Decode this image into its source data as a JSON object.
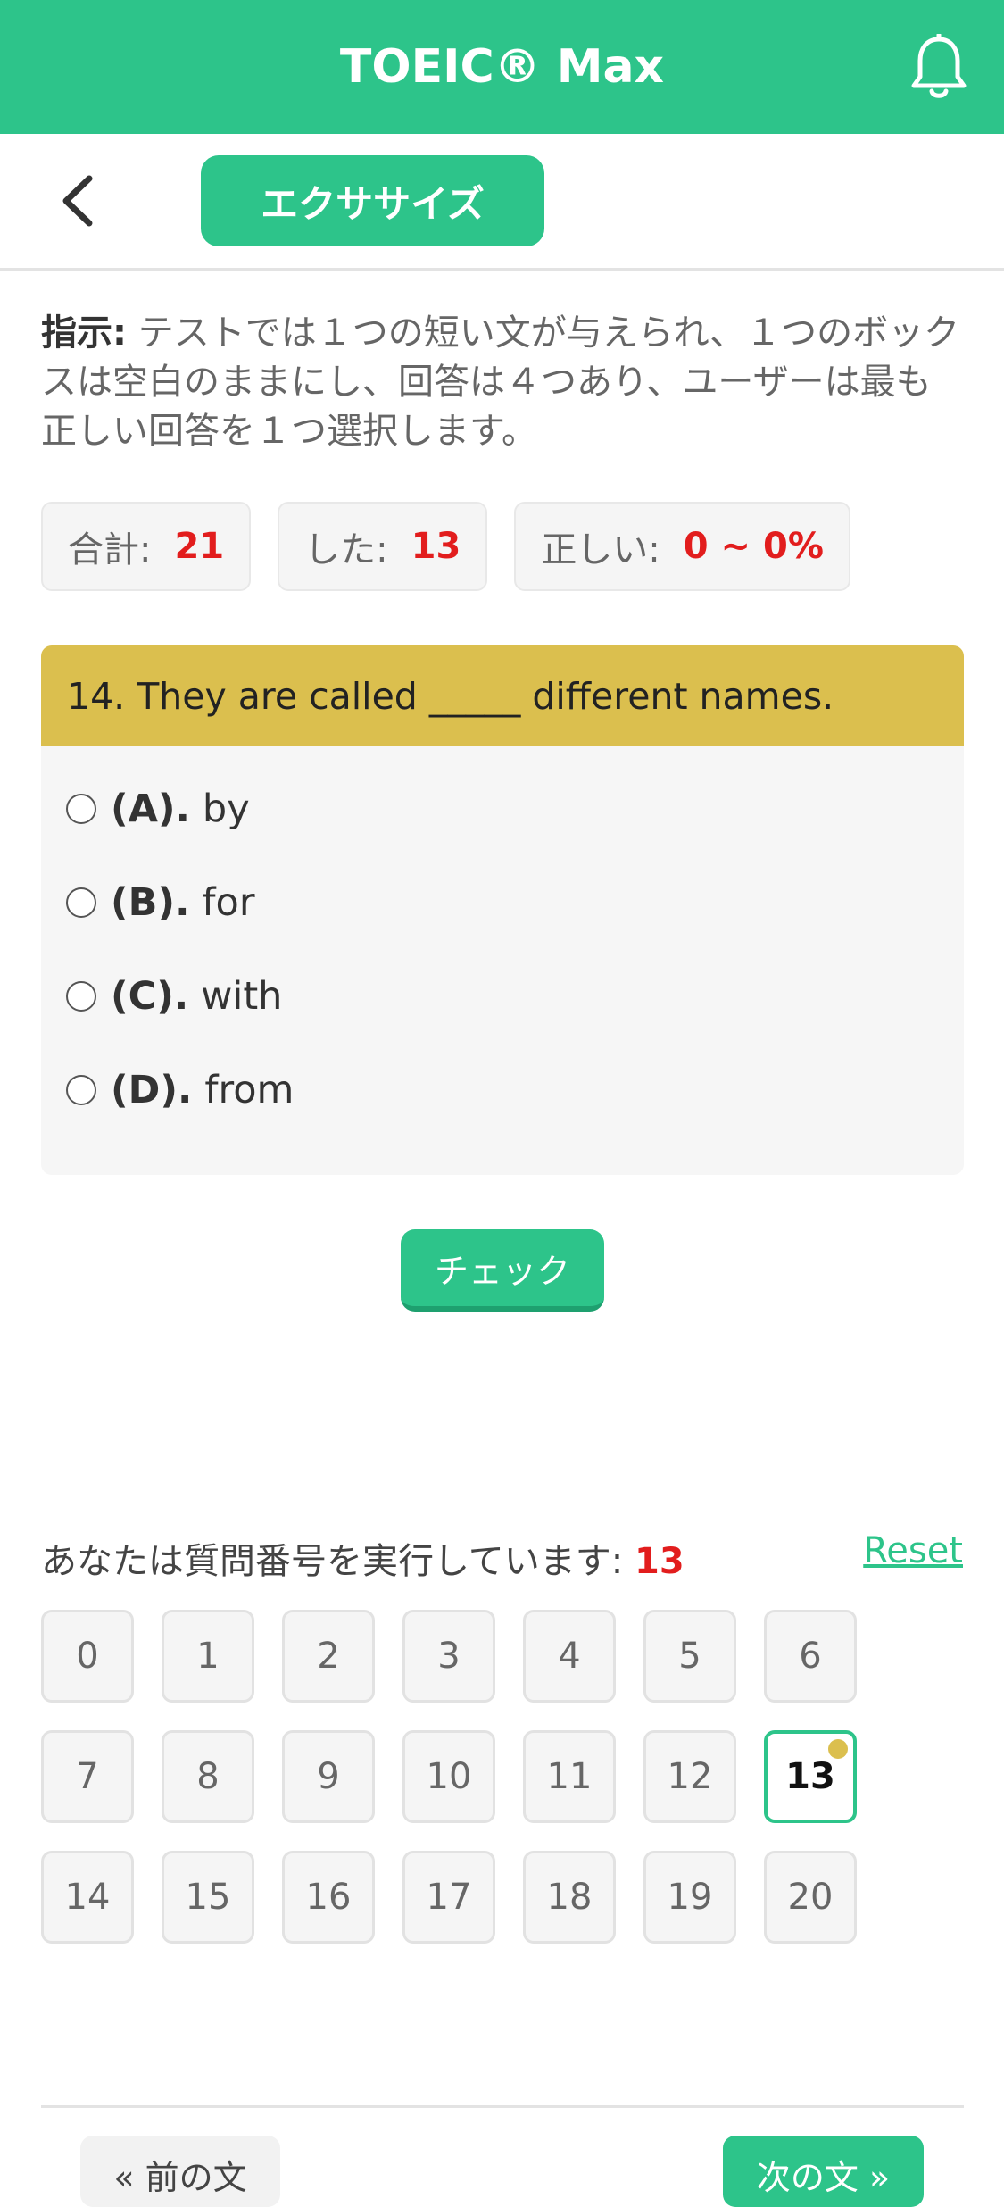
{
  "header": {
    "title": "TOEIC® Max",
    "notification_icon": "bell-icon"
  },
  "subbar": {
    "back_icon": "chevron-left-icon",
    "tab_label": "エクササイズ"
  },
  "instruction": {
    "label": "指示:",
    "text": "テストでは１つの短い文が与えられ、１つのボックスは空白のままにし、回答は４つあり、ユーザーは最も正しい回答を１つ選択します。"
  },
  "stats": [
    {
      "label": "合計:",
      "value": "21"
    },
    {
      "label": "した:",
      "value": "13"
    },
    {
      "label": "正しい:",
      "value": "0 ~ 0%"
    }
  ],
  "question": {
    "text": "14. They are called _____ different names.",
    "options": [
      {
        "key": "(A).",
        "text": "by"
      },
      {
        "key": "(B).",
        "text": "for"
      },
      {
        "key": "(C).",
        "text": "with"
      },
      {
        "key": "(D).",
        "text": "from"
      }
    ]
  },
  "check_button": "チェック",
  "progress": {
    "running_label": "あなたは質問番号を実行しています:",
    "current": "13",
    "reset_label": "Reset",
    "numbers": [
      "0",
      "1",
      "2",
      "3",
      "4",
      "5",
      "6",
      "7",
      "8",
      "9",
      "10",
      "11",
      "12",
      "13",
      "14",
      "15",
      "16",
      "17",
      "18",
      "19",
      "20"
    ],
    "active_index": 13
  },
  "nav": {
    "prev_label": "« 前の文",
    "next_label": "次の文 »"
  },
  "colors": {
    "brand": "#2dc48a",
    "question_header": "#dbbf4e",
    "highlight": "#e21d1d"
  }
}
